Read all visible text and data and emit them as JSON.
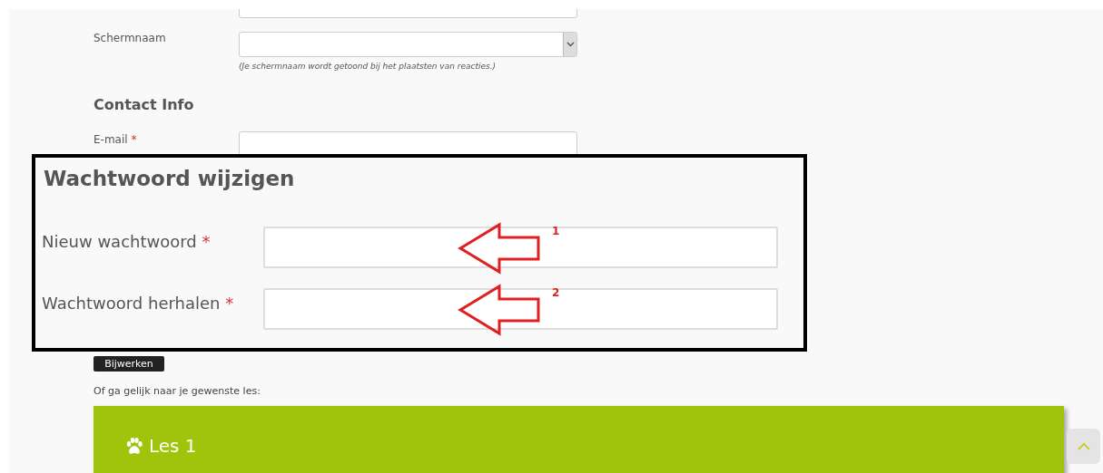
{
  "form": {
    "screen_name": {
      "label": "Schermnaam",
      "hint": "(Je schermnaam wordt getoond bij het plaatsten van reacties.)"
    },
    "section_title": "Contact Info",
    "email": {
      "label": "E-mail",
      "required_mark": "*"
    },
    "submit_button": "Bijwerken"
  },
  "callout": {
    "title": "Wachtwoord wijzigen",
    "fields": [
      {
        "label": "Nieuw wachtwoord",
        "required_mark": "*",
        "arrow_number": "1"
      },
      {
        "label": "Wachtwoord herhalen",
        "required_mark": "*",
        "arrow_number": "2"
      }
    ]
  },
  "lessons": {
    "intro": "Of ga gelijk naar je gewenste les:",
    "items": [
      {
        "title": "Les 1"
      }
    ]
  }
}
